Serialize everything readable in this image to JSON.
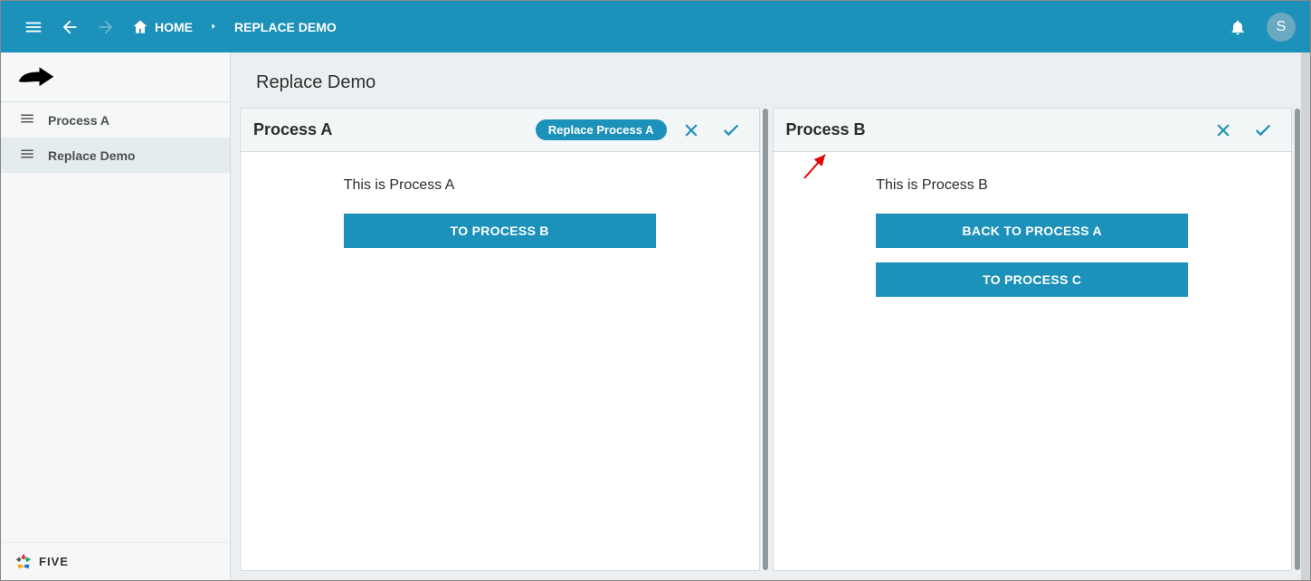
{
  "header": {
    "home_label": "HOME",
    "breadcrumb_current": "REPLACE DEMO",
    "avatar_initial": "S"
  },
  "sidebar": {
    "items": [
      {
        "label": "Process A",
        "active": false
      },
      {
        "label": "Replace Demo",
        "active": true
      }
    ],
    "footer_brand": "FIVE"
  },
  "page": {
    "title": "Replace Demo"
  },
  "panels": {
    "a": {
      "title": "Process A",
      "chip": "Replace Process A",
      "body_text": "This is Process A",
      "buttons": [
        {
          "label": "TO PROCESS B"
        }
      ]
    },
    "b": {
      "title": "Process B",
      "body_text": "This is Process B",
      "buttons": [
        {
          "label": "BACK TO PROCESS A"
        },
        {
          "label": "TO PROCESS C"
        }
      ]
    }
  },
  "colors": {
    "brand": "#1c91b9"
  }
}
